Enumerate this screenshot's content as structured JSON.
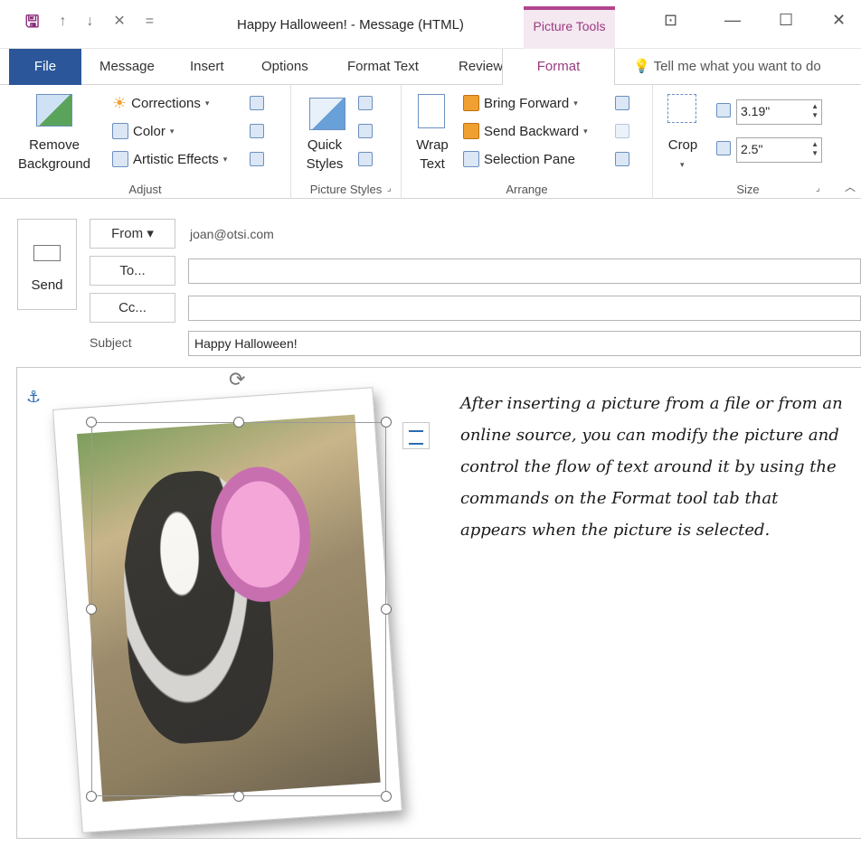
{
  "window": {
    "title": "Happy Halloween!  -  Message (HTML)",
    "context_tab": "Picture Tools",
    "controls": [
      "—",
      "☐",
      "✕"
    ]
  },
  "tabs": [
    "File",
    "Message",
    "Insert",
    "Options",
    "Format Text",
    "Review",
    "Format"
  ],
  "active_tab": "Format",
  "tell_me": "Tell me what you want to do",
  "ribbon": {
    "adjust": {
      "label": "Adjust",
      "remove_background": [
        "Remove",
        "Background"
      ],
      "corrections": "Corrections",
      "color": "Color",
      "artistic_effects": "Artistic Effects"
    },
    "picture_styles": {
      "label": "Picture Styles",
      "quick_styles": [
        "Quick",
        "Styles"
      ]
    },
    "arrange": {
      "label": "Arrange",
      "wrap_text": [
        "Wrap",
        "Text"
      ],
      "bring_forward": "Bring Forward",
      "send_backward": "Send Backward",
      "selection_pane": "Selection Pane"
    },
    "size": {
      "label": "Size",
      "crop": "Crop",
      "height": "3.19\"",
      "width": "2.5\""
    }
  },
  "header": {
    "send": "Send",
    "from_button": "From",
    "from_value": "joan@otsi.com",
    "to_button": "To...",
    "cc_button": "Cc...",
    "subject_label": "Subject",
    "subject_value": "Happy Halloween!"
  },
  "body": {
    "text": "After inserting a picture from a file or from an online source, you can modify the picture and control the flow of text around it by using the commands on the Format tool tab that appears when the picture is selected."
  },
  "colors": {
    "file_tab": "#2b579a",
    "context_accent": "#b0458c"
  }
}
